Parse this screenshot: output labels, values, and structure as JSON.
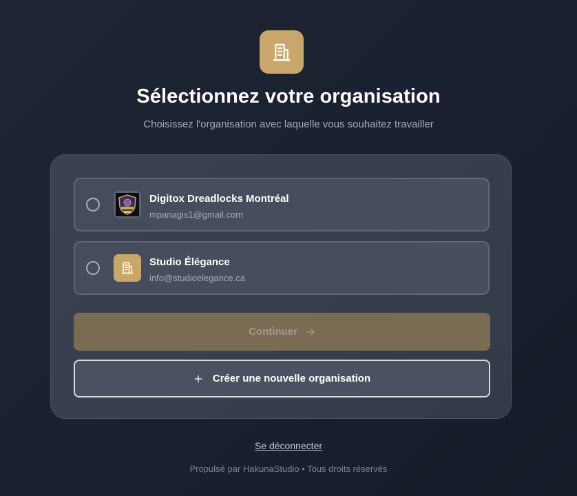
{
  "header": {
    "logo_icon": "building-icon",
    "title": "Sélectionnez votre organisation",
    "subtitle": "Choisissez l'organisation avec laquelle vous souhaitez travailler"
  },
  "organizations": [
    {
      "name": "Digitox Dreadlocks Montréal",
      "email": "mpanagis1@gmail.com",
      "avatar": "shield-logo-image",
      "selected": false
    },
    {
      "name": "Studio Élégance",
      "email": "info@studioelegance.ca",
      "avatar": "building-icon",
      "selected": false
    }
  ],
  "actions": {
    "continue_label": "Continuer",
    "continue_icon": "arrow-right-icon",
    "continue_enabled": false,
    "create_label": "Créer une nouvelle organisation",
    "create_icon": "plus-icon"
  },
  "footer": {
    "logout_label": "Se déconnecter",
    "credit": "Propulsé par HakunaStudio • Tous droits réservés"
  },
  "colors": {
    "accent_gold": "#c9a76a",
    "continue_disabled": "#7a6c52",
    "background": "#1a2130",
    "card": "#373f4d"
  }
}
